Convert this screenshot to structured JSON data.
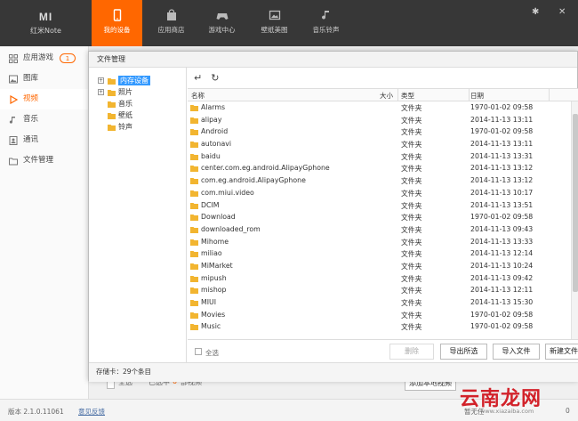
{
  "app": {
    "logo": "MI",
    "model": "红米Note"
  },
  "nav": {
    "tabs": [
      {
        "label": "我的设备",
        "icon": "phone-icon",
        "active": true
      },
      {
        "label": "应用商店",
        "icon": "shopping-bag-icon"
      },
      {
        "label": "游戏中心",
        "icon": "gamepad-icon"
      },
      {
        "label": "壁纸美图",
        "icon": "image-icon"
      },
      {
        "label": "音乐铃声",
        "icon": "music-note-icon"
      }
    ]
  },
  "window_controls": [
    "gear-icon",
    "close-icon"
  ],
  "sidebar": {
    "items": [
      {
        "label": "应用游戏",
        "badge": "1",
        "icon": "apps-grid-icon"
      },
      {
        "label": "图库",
        "icon": "picture-icon"
      },
      {
        "label": "视频",
        "icon": "play-icon",
        "active": true
      },
      {
        "label": "音乐",
        "icon": "music-icon"
      },
      {
        "label": "通讯",
        "icon": "contacts-icon"
      },
      {
        "label": "文件管理",
        "icon": "folder-icon"
      }
    ]
  },
  "background_bar": {
    "select_all": "全选",
    "selected_prefix": "已选中",
    "selected_count": "0",
    "selected_suffix": "部视频",
    "add_local": "添加本地视频"
  },
  "status": {
    "version": "版本 2.1.0.11061",
    "feedback": "意见反馈",
    "right_text": "暂无任",
    "download_count": "0"
  },
  "dialog": {
    "title": "文件管理",
    "tree": [
      {
        "label": "内存设备",
        "expandable": true,
        "selected": true,
        "level": 0
      },
      {
        "label": "照片",
        "expandable": true,
        "level": 0
      },
      {
        "label": "音乐",
        "level": 0
      },
      {
        "label": "壁纸",
        "level": 0
      },
      {
        "label": "铃声",
        "level": 0
      }
    ],
    "toolbar": {
      "back_icon": "back-arrow-icon",
      "refresh_icon": "refresh-icon"
    },
    "columns": {
      "name": "名称",
      "size": "大小",
      "type": "类型",
      "date": "日期"
    },
    "files": [
      {
        "name": "Alarms",
        "type": "文件夹",
        "date": "1970-01-02 09:58"
      },
      {
        "name": "alipay",
        "type": "文件夹",
        "date": "2014-11-13 13:11"
      },
      {
        "name": "Android",
        "type": "文件夹",
        "date": "1970-01-02 09:58"
      },
      {
        "name": "autonavi",
        "type": "文件夹",
        "date": "2014-11-13 13:11"
      },
      {
        "name": "baidu",
        "type": "文件夹",
        "date": "2014-11-13 13:31"
      },
      {
        "name": "center.com.eg.android.AlipayGphone",
        "type": "文件夹",
        "date": "2014-11-13 13:12"
      },
      {
        "name": "com.eg.android.AlipayGphone",
        "type": "文件夹",
        "date": "2014-11-13 13:12"
      },
      {
        "name": "com.miui.video",
        "type": "文件夹",
        "date": "2014-11-13 10:17"
      },
      {
        "name": "DCIM",
        "type": "文件夹",
        "date": "2014-11-13 13:51"
      },
      {
        "name": "Download",
        "type": "文件夹",
        "date": "1970-01-02 09:58"
      },
      {
        "name": "downloaded_rom",
        "type": "文件夹",
        "date": "2014-11-13 09:43"
      },
      {
        "name": "Mihome",
        "type": "文件夹",
        "date": "2014-11-13 13:33"
      },
      {
        "name": "miliao",
        "type": "文件夹",
        "date": "2014-11-13 12:14"
      },
      {
        "name": "MiMarket",
        "type": "文件夹",
        "date": "2014-11-13 10:24"
      },
      {
        "name": "mipush",
        "type": "文件夹",
        "date": "2014-11-13 09:42"
      },
      {
        "name": "mishop",
        "type": "文件夹",
        "date": "2014-11-13 12:11"
      },
      {
        "name": "MIUI",
        "type": "文件夹",
        "date": "2014-11-13 15:30"
      },
      {
        "name": "Movies",
        "type": "文件夹",
        "date": "1970-01-02 09:58"
      },
      {
        "name": "Music",
        "type": "文件夹",
        "date": "1970-01-02 09:58"
      }
    ],
    "bottom": {
      "select_all": "全选",
      "delete": "删除",
      "export": "导出所选",
      "import": "导入文件",
      "new_folder": "新建文件"
    },
    "footer": "存储卡：29个条目"
  },
  "watermark": {
    "text": "云南龙网",
    "sub": "www.xiazaiba.com"
  },
  "colors": {
    "accent": "#ff6700",
    "topbar": "#373737",
    "selection": "#3399ff",
    "folder": "#f2b530"
  }
}
